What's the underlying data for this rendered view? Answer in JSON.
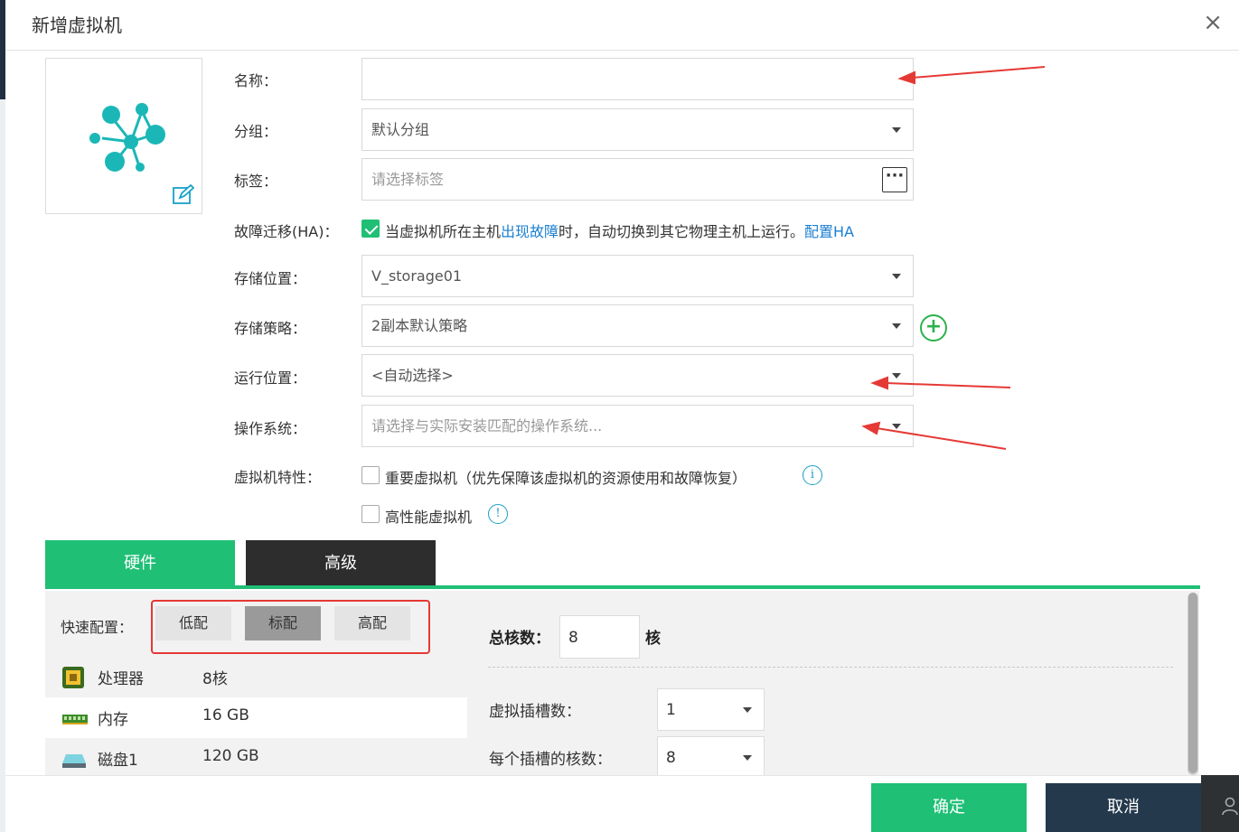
{
  "dialog": {
    "title": "新增虚拟机",
    "close_glyph": "×"
  },
  "form": {
    "name_label": "名称：",
    "name_value": "",
    "group_label": "分组：",
    "group_value": "默认分组",
    "tag_label": "标签：",
    "tag_placeholder": "请选择标签",
    "tag_more_glyph": "···",
    "ha_label": "故障迁移(HA)：",
    "ha_checked": true,
    "ha_text_1": "当虚拟机所在主机",
    "ha_text_link": "出现故障",
    "ha_text_2": "时，自动切换到其它物理主机上运行。",
    "ha_config_link": "配置HA",
    "storage_label": "存储位置：",
    "storage_value": "V_storage01",
    "policy_label": "存储策略：",
    "policy_value": "2副本默认策略",
    "run_label": "运行位置：",
    "run_value": "<自动选择>",
    "os_label": "操作系统：",
    "os_placeholder": "请选择与实际安装匹配的操作系统...",
    "feature_label": "虚拟机特性：",
    "feature_important": "重要虚拟机（优先保障该虚拟机的资源使用和故障恢复）",
    "feature_important_checked": false,
    "feature_hp": "高性能虚拟机",
    "feature_hp_checked": false,
    "info_glyph": "i",
    "hp_info_glyph": "!"
  },
  "tabs": [
    {
      "label": "硬件",
      "active": true
    },
    {
      "label": "高级",
      "active": false
    }
  ],
  "quick_config": {
    "label": "快速配置：",
    "presets": [
      "低配",
      "标配",
      "高配"
    ],
    "selected": "标配"
  },
  "hardware": [
    {
      "name": "处理器",
      "value": "8核",
      "icon": "cpu-icon"
    },
    {
      "name": "内存",
      "value": "16 GB",
      "icon": "memory-icon"
    },
    {
      "name": "磁盘1",
      "value": "120 GB",
      "icon": "disk-icon"
    }
  ],
  "cpu": {
    "total_label": "总核数：",
    "total_value": "8",
    "total_unit": "核",
    "sockets_label": "虚拟插槽数：",
    "sockets_value": "1",
    "cores_label": "每个插槽的核数：",
    "cores_value": "8"
  },
  "footer": {
    "ok_label": "确定",
    "cancel_label": "取消"
  },
  "colors": {
    "accent": "#1fbf75",
    "dark_tab": "#2d2d2d",
    "cancel": "#24394c",
    "link": "#1a7fd1",
    "annotation": "#e53935"
  }
}
